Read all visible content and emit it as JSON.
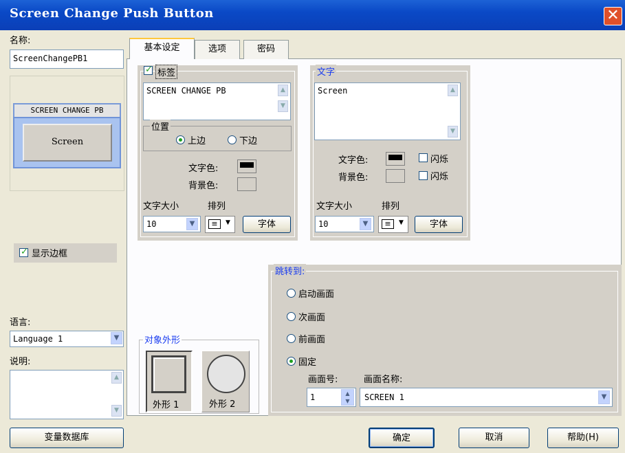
{
  "window": {
    "title": "Screen Change Push Button",
    "close_glyph": "✕"
  },
  "left": {
    "name_label": "名称:",
    "name_value": "ScreenChangePB1",
    "preview_label": "SCREEN CHANGE PB",
    "preview_button_text": "Screen",
    "show_border_label": "显示边框",
    "language_label": "语言:",
    "language_value": "Language 1",
    "description_label": "说明:",
    "variable_db_button": "变量数据库"
  },
  "tabs": [
    {
      "label": "基本设定",
      "active": true
    },
    {
      "label": "选项",
      "active": false
    },
    {
      "label": "密码",
      "active": false
    }
  ],
  "label_group": {
    "title": "标签",
    "text": "SCREEN CHANGE PB",
    "position_title": "位置",
    "pos_top": "上边",
    "pos_bottom": "下边",
    "text_color_label": "文字色:",
    "bg_color_label": "背景色:",
    "font_size_label": "文字大小",
    "align_label": "排列",
    "font_size_value": "10",
    "font_button": "字体",
    "text_color": "#000000"
  },
  "text_group": {
    "title": "文字",
    "text": "Screen",
    "text_color_label": "文字色:",
    "bg_color_label": "背景色:",
    "blink_label_1": "闪烁",
    "blink_label_2": "闪烁",
    "font_size_label": "文字大小",
    "align_label": "排列",
    "font_size_value": "10",
    "font_button": "字体"
  },
  "shape_group": {
    "title": "对象外形",
    "shape1": "外形 1",
    "shape2": "外形 2"
  },
  "jump_group": {
    "title": "跳转到:",
    "options": [
      "启动画面",
      "次画面",
      "前画面",
      "固定"
    ],
    "selected": "固定",
    "screen_no_label": "画面号:",
    "screen_name_label": "画面名称:",
    "screen_no_value": "1",
    "screen_name_value": "SCREEN 1"
  },
  "footer": {
    "ok": "确定",
    "cancel": "取消",
    "help": "帮助(H)"
  },
  "colors": {
    "title_bar": "#0a49c6",
    "accent_blue": "#1a3cf0",
    "check_green": "#21a121"
  }
}
